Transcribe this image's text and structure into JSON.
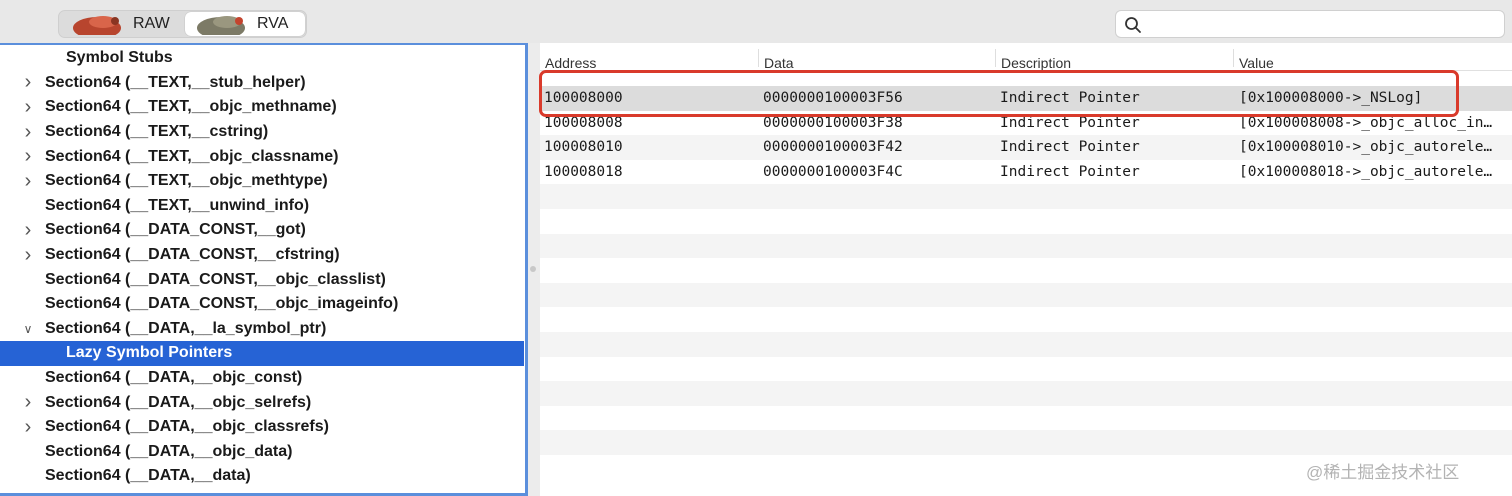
{
  "toolbar": {
    "raw_label": "RAW",
    "rva_label": "RVA",
    "selected_mode": "RVA",
    "search": {
      "value": "",
      "placeholder": ""
    }
  },
  "sidebar": {
    "items": [
      {
        "label": "Symbol Stubs",
        "expandable": false,
        "expanded": false,
        "level": 2,
        "selected": false
      },
      {
        "label": "Section64 (__TEXT,__stub_helper)",
        "expandable": true,
        "expanded": false,
        "level": 1,
        "selected": false
      },
      {
        "label": "Section64 (__TEXT,__objc_methname)",
        "expandable": true,
        "expanded": false,
        "level": 1,
        "selected": false
      },
      {
        "label": "Section64 (__TEXT,__cstring)",
        "expandable": true,
        "expanded": false,
        "level": 1,
        "selected": false
      },
      {
        "label": "Section64 (__TEXT,__objc_classname)",
        "expandable": true,
        "expanded": false,
        "level": 1,
        "selected": false
      },
      {
        "label": "Section64 (__TEXT,__objc_methtype)",
        "expandable": true,
        "expanded": false,
        "level": 1,
        "selected": false
      },
      {
        "label": "Section64 (__TEXT,__unwind_info)",
        "expandable": false,
        "expanded": false,
        "level": 1,
        "selected": false
      },
      {
        "label": "Section64 (__DATA_CONST,__got)",
        "expandable": true,
        "expanded": false,
        "level": 1,
        "selected": false
      },
      {
        "label": "Section64 (__DATA_CONST,__cfstring)",
        "expandable": true,
        "expanded": false,
        "level": 1,
        "selected": false
      },
      {
        "label": "Section64 (__DATA_CONST,__objc_classlist)",
        "expandable": false,
        "expanded": false,
        "level": 1,
        "selected": false
      },
      {
        "label": "Section64 (__DATA_CONST,__objc_imageinfo)",
        "expandable": false,
        "expanded": false,
        "level": 1,
        "selected": false
      },
      {
        "label": "Section64 (__DATA,__la_symbol_ptr)",
        "expandable": true,
        "expanded": true,
        "level": 1,
        "selected": false
      },
      {
        "label": "Lazy Symbol Pointers",
        "expandable": false,
        "expanded": false,
        "level": 2,
        "selected": true
      },
      {
        "label": "Section64 (__DATA,__objc_const)",
        "expandable": false,
        "expanded": false,
        "level": 1,
        "selected": false
      },
      {
        "label": "Section64 (__DATA,__objc_selrefs)",
        "expandable": true,
        "expanded": false,
        "level": 1,
        "selected": false
      },
      {
        "label": "Section64 (__DATA,__objc_classrefs)",
        "expandable": true,
        "expanded": false,
        "level": 1,
        "selected": false
      },
      {
        "label": "Section64 (__DATA,__objc_data)",
        "expandable": false,
        "expanded": false,
        "level": 1,
        "selected": false
      },
      {
        "label": "Section64 (__DATA,__data)",
        "expandable": false,
        "expanded": false,
        "level": 1,
        "selected": false
      }
    ]
  },
  "table": {
    "columns": [
      "Address",
      "Data",
      "Description",
      "Value"
    ],
    "rows": [
      {
        "address": "100008000",
        "data": "0000000100003F56",
        "description": "Indirect Pointer",
        "value": "[0x100008000->_NSLog]",
        "highlighted": true
      },
      {
        "address": "100008008",
        "data": "0000000100003F38",
        "description": "Indirect Pointer",
        "value": "[0x100008008->_objc_alloc_in…",
        "highlighted": false
      },
      {
        "address": "100008010",
        "data": "0000000100003F42",
        "description": "Indirect Pointer",
        "value": "[0x100008010->_objc_autorele…",
        "highlighted": false
      },
      {
        "address": "100008018",
        "data": "0000000100003F4C",
        "description": "Indirect Pointer",
        "value": "[0x100008018->_objc_autorele…",
        "highlighted": false
      }
    ],
    "empty_row_count": 12
  },
  "annotation": {
    "color": "#d93a2b"
  },
  "watermark": "@稀土掘金技术社区",
  "colors": {
    "selection": "#2663d5",
    "sidebar_border": "#5b8fdc"
  }
}
